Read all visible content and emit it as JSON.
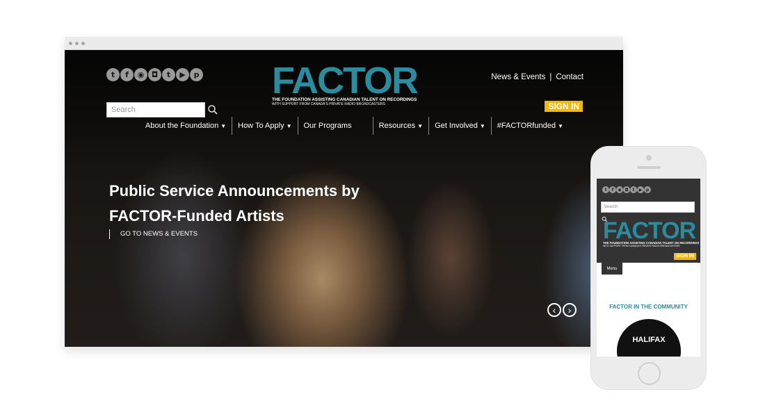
{
  "desktop": {
    "social_icons": [
      {
        "name": "twitter-icon",
        "glyph": "t"
      },
      {
        "name": "facebook-icon",
        "glyph": "f"
      },
      {
        "name": "music-icon",
        "glyph": "◉"
      },
      {
        "name": "instagram-icon",
        "glyph": "◘"
      },
      {
        "name": "tumblr-icon",
        "glyph": "t"
      },
      {
        "name": "youtube-icon",
        "glyph": "▶"
      },
      {
        "name": "pinterest-icon",
        "glyph": "p"
      }
    ],
    "search_placeholder": "Search",
    "logo": {
      "word": "FACTOR",
      "tagline1": "THE FOUNDATION ASSISTING CANADIAN TALENT ON RECORDINGS",
      "tagline2": "WITH SUPPORT FROM CANADA'S PRIVATE RADIO BROADCASTERS"
    },
    "top_links": {
      "news": "News & Events",
      "sep": "|",
      "contact": "Contact"
    },
    "sign_in": "SIGN IN",
    "nav": [
      {
        "label": "About the Foundation",
        "caret": "▼"
      },
      {
        "label": "How To Apply",
        "caret": "▼"
      },
      {
        "label": "Our Programs",
        "caret": ""
      },
      {
        "label": "Resources",
        "caret": "▼"
      },
      {
        "label": "Get Involved",
        "caret": "▼"
      },
      {
        "label": "#FACTORfunded",
        "caret": "▼"
      }
    ],
    "hero": {
      "title_line1": "Public Service Announcements by",
      "title_line2": "FACTOR-Funded Artists",
      "link": "GO TO NEWS & EVENTS"
    },
    "arrows": {
      "prev": "‹",
      "next": "›"
    }
  },
  "mobile": {
    "search_placeholder": "Search",
    "logo": {
      "word": "FACTOR",
      "tagline1": "THE FOUNDATION ASSISTING CANADIAN TALENT ON RECORDINGS",
      "tagline2": "WITH SUPPORT FROM CANADA'S PRIVATE RADIO BROADCASTERS"
    },
    "sign_in": "SIGN IN",
    "menu": "Menu",
    "section_title": "FACTOR IN THE COMMUNITY",
    "badge": "HALIFAX"
  },
  "colors": {
    "accent": "#2a8c9e",
    "sign_in": "#f5b700"
  }
}
